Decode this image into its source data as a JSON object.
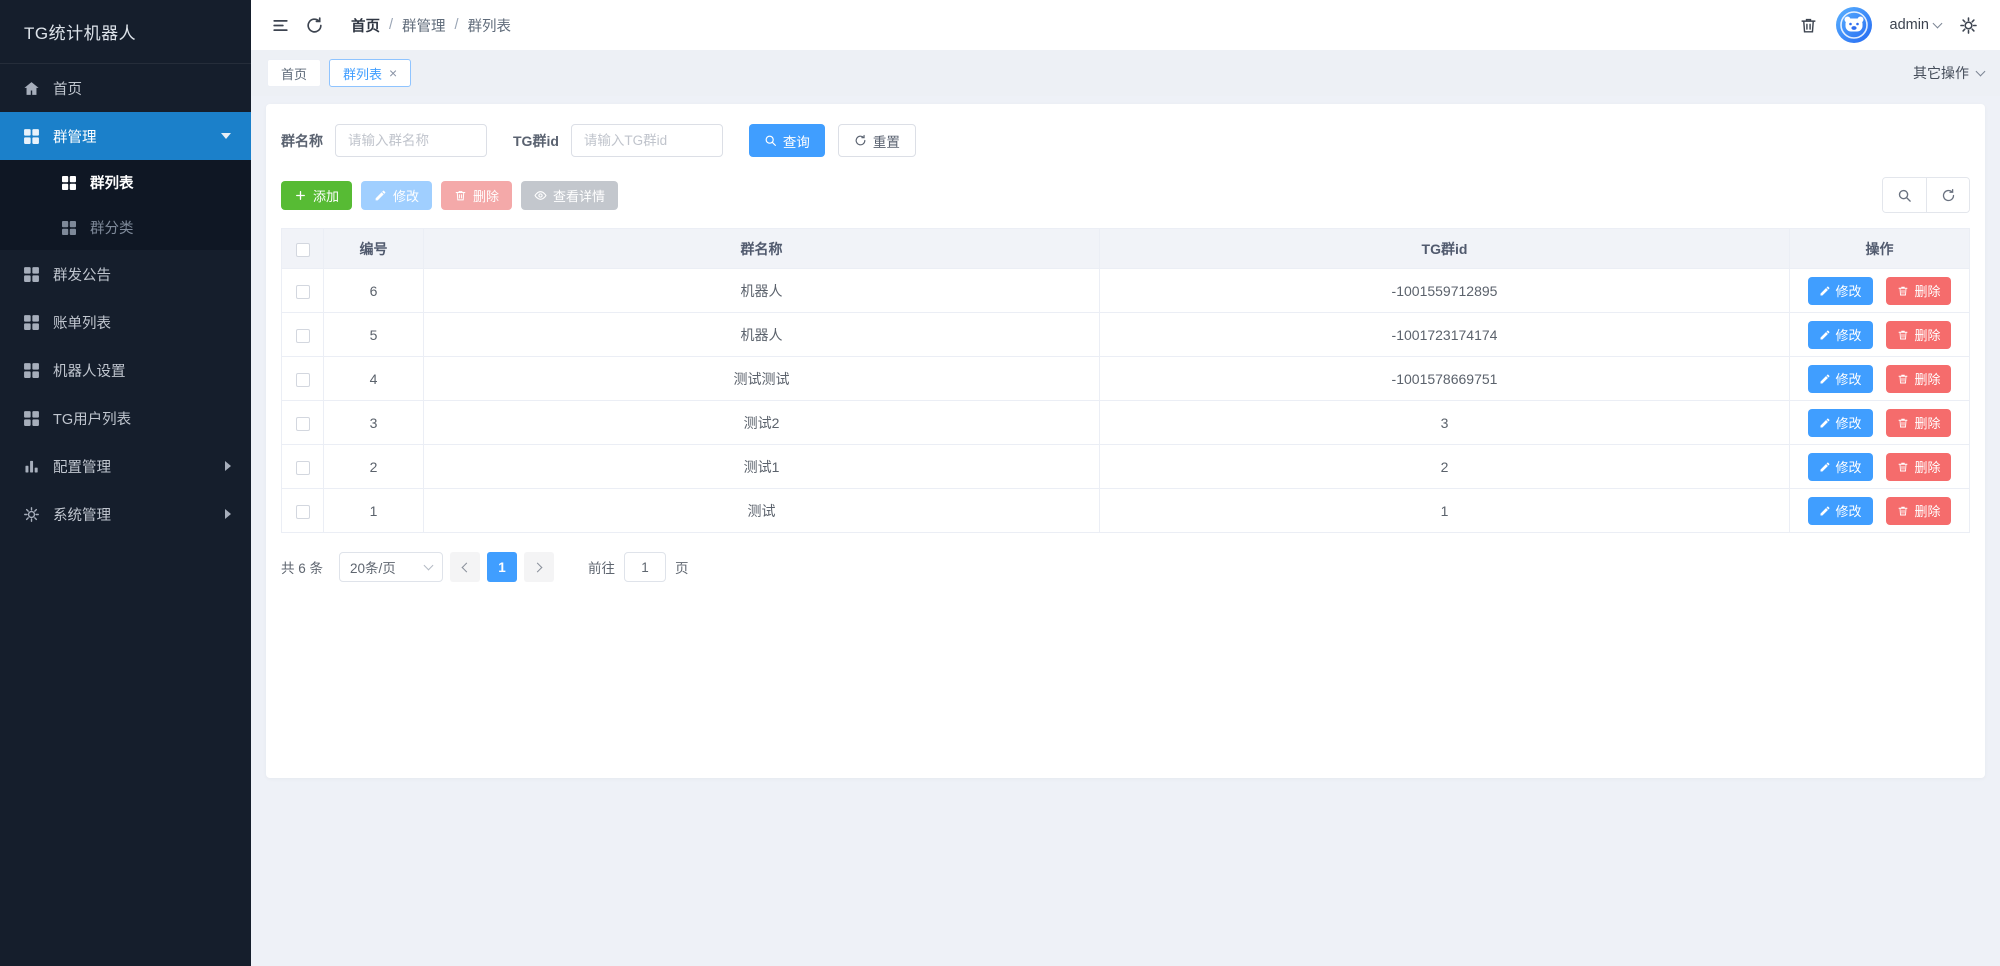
{
  "app": {
    "title": "TG统计机器人"
  },
  "sidebar": {
    "items": [
      {
        "label": "首页",
        "icon": "home"
      },
      {
        "label": "群管理",
        "icon": "grid",
        "expanded": true,
        "children": [
          {
            "label": "群列表",
            "active": true
          },
          {
            "label": "群分类"
          }
        ]
      },
      {
        "label": "群发公告",
        "icon": "grid"
      },
      {
        "label": "账单列表",
        "icon": "grid"
      },
      {
        "label": "机器人设置",
        "icon": "grid"
      },
      {
        "label": "TG用户列表",
        "icon": "grid"
      },
      {
        "label": "配置管理",
        "icon": "chart",
        "collapsed": true
      },
      {
        "label": "系统管理",
        "icon": "gear",
        "collapsed": true
      }
    ]
  },
  "navbar": {
    "breadcrumb": [
      "首页",
      "群管理",
      "群列表"
    ],
    "separator": "/",
    "user": "admin"
  },
  "tabbar": {
    "tabs": [
      {
        "label": "首页"
      },
      {
        "label": "群列表",
        "active": true
      }
    ],
    "close_glyph": "×",
    "other_actions": "其它操作"
  },
  "search": {
    "name_label": "群名称",
    "name_placeholder": "请输入群名称",
    "id_label": "TG群id",
    "id_placeholder": "请输入TG群id",
    "query_label": "查询",
    "reset_label": "重置"
  },
  "toolbar": {
    "add_label": "添加",
    "edit_label": "修改",
    "delete_label": "删除",
    "detail_label": "查看详情"
  },
  "table": {
    "headers": [
      "编号",
      "群名称",
      "TG群id",
      "操作"
    ],
    "row_edit_label": "修改",
    "row_delete_label": "删除",
    "rows": [
      {
        "id": "6",
        "name": "机器人",
        "tgid": "-1001559712895"
      },
      {
        "id": "5",
        "name": "机器人",
        "tgid": "-1001723174174"
      },
      {
        "id": "4",
        "name": "测试测试",
        "tgid": "-1001578669751"
      },
      {
        "id": "3",
        "name": "测试2",
        "tgid": "3"
      },
      {
        "id": "2",
        "name": "测试1",
        "tgid": "2"
      },
      {
        "id": "1",
        "name": "测试",
        "tgid": "1"
      }
    ]
  },
  "pagination": {
    "total_text": "共 6 条",
    "page_size_text": "20条/页",
    "current_page": "1",
    "goto_label": "前往",
    "goto_value": "1",
    "page_unit": "页"
  },
  "colors": {
    "sidebar_bg": "#151e2c",
    "submenu_bg": "#0f1724",
    "sidebar_active": "#1b80ca",
    "primary": "#409eff",
    "success": "#57bb34",
    "danger": "#f56c6c",
    "disabled_primary": "#a0cfff",
    "disabled_danger": "#f4a9a9",
    "disabled_info": "#c3c7cd",
    "content_bg": "#eef1f7"
  }
}
